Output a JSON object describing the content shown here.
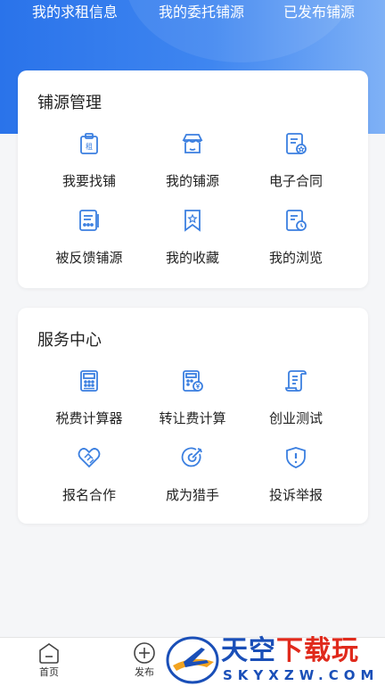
{
  "colors": {
    "accent": "#2a73ea",
    "icon": "#3b7fe0",
    "watermark_blue": "#1a4fb8",
    "watermark_red": "#e02a1c"
  },
  "header": {
    "tabs": [
      "我的求租信息",
      "我的委托铺源",
      "已发布铺源"
    ]
  },
  "cards": [
    {
      "title": "铺源管理",
      "items": [
        {
          "label": "我要找铺",
          "icon": "rent-sign-icon"
        },
        {
          "label": "我的铺源",
          "icon": "storefront-icon"
        },
        {
          "label": "电子合同",
          "icon": "contract-icon"
        },
        {
          "label": "被反馈铺源",
          "icon": "feedback-icon"
        },
        {
          "label": "我的收藏",
          "icon": "bookmark-icon"
        },
        {
          "label": "我的浏览",
          "icon": "history-icon"
        }
      ]
    },
    {
      "title": "服务中心",
      "items": [
        {
          "label": "税费计算器",
          "icon": "calculator-icon"
        },
        {
          "label": "转让费计算",
          "icon": "fee-calculator-icon"
        },
        {
          "label": "创业测试",
          "icon": "scroll-icon"
        },
        {
          "label": "报名合作",
          "icon": "handshake-icon"
        },
        {
          "label": "成为猎手",
          "icon": "target-icon"
        },
        {
          "label": "投诉举报",
          "icon": "shield-alert-icon"
        }
      ]
    }
  ],
  "bottom_nav": [
    {
      "label": "首页",
      "icon": "home-icon"
    },
    {
      "label": "发布",
      "icon": "plus-circle-icon"
    }
  ],
  "watermark": {
    "text_a": "天空",
    "text_b": "下载玩",
    "text_c": "SKYXZW.COM"
  }
}
